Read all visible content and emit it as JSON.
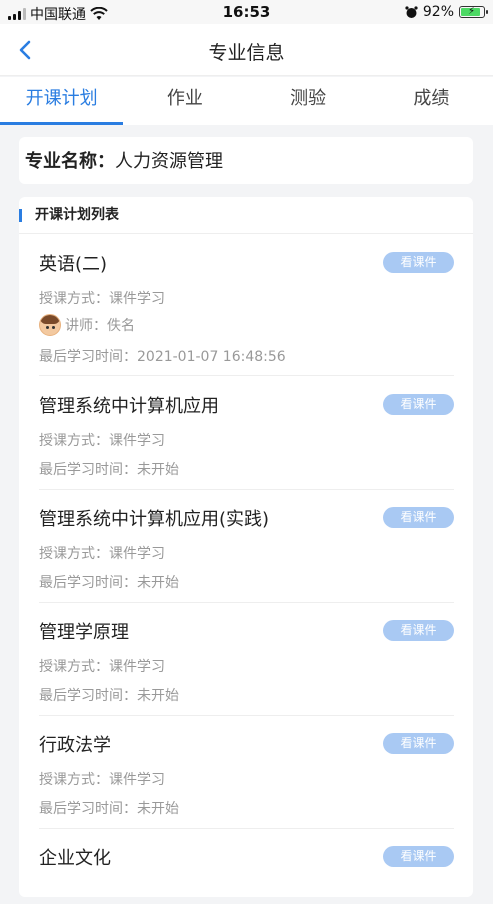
{
  "status": {
    "carrier": "中国联通",
    "time": "16:53",
    "battery": "92%",
    "battery_level": 0.92
  },
  "nav": {
    "title": "专业信息",
    "back_icon": "chevron-left-icon"
  },
  "tabs": [
    {
      "label": "开课计划",
      "active": true
    },
    {
      "label": "作业",
      "active": false
    },
    {
      "label": "测验",
      "active": false
    },
    {
      "label": "成绩",
      "active": false
    }
  ],
  "major": {
    "label": "专业名称：",
    "value": "人力资源管理"
  },
  "list": {
    "title": "开课计划列表",
    "courses": [
      {
        "name": "英语(二)",
        "button": "看课件",
        "method": "授课方式：课件学习",
        "teacher": "讲师：佚名",
        "last_study": "最后学习时间：2021-01-07 16:48:56"
      },
      {
        "name": "管理系统中计算机应用",
        "button": "看课件",
        "method": "授课方式：课件学习",
        "last_study": "最后学习时间：未开始"
      },
      {
        "name": "管理系统中计算机应用(实践)",
        "button": "看课件",
        "method": "授课方式：课件学习",
        "last_study": "最后学习时间：未开始"
      },
      {
        "name": "管理学原理",
        "button": "看课件",
        "method": "授课方式：课件学习",
        "last_study": "最后学习时间：未开始"
      },
      {
        "name": "行政法学",
        "button": "看课件",
        "method": "授课方式：课件学习",
        "last_study": "最后学习时间：未开始"
      },
      {
        "name": "企业文化",
        "button": "看课件"
      }
    ]
  }
}
